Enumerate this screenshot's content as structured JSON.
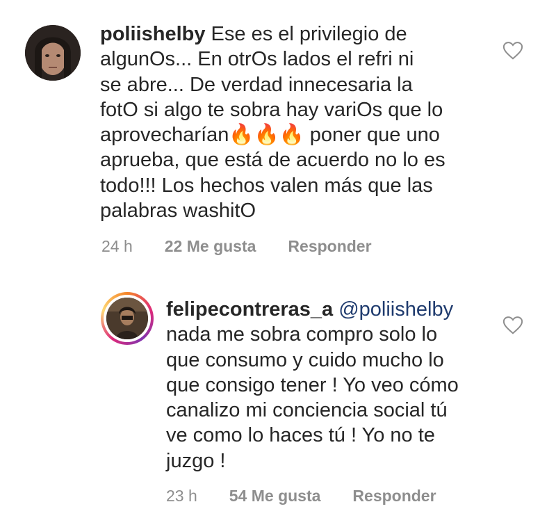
{
  "comments": [
    {
      "username": "poliishelby",
      "text": " Ese es el privilegio de\nalgunOs... En otrOs lados el refri ni\nse abre... De verdad innecesaria la\nfotO si algo te sobra hay variOs que lo\naprovecharían🔥🔥🔥 poner que uno\naprueba, que está de acuerdo no lo es\ntodo!!! Los hechos valen más que las\npalabras washitO",
      "time": "24 h",
      "likes": "22 Me gusta",
      "reply": "Responder",
      "icon": "heart-outline-icon"
    },
    {
      "username": "felipecontreras_a",
      "mention": " @poliishelby",
      "text": "\nnada me sobra compro solo lo\nque consumo y cuido mucho lo\nque consigo tener ! Yo veo cómo\ncanalizo mi conciencia social tú\nve como lo haces tú ! Yo no te\njuzgo !",
      "time": "23 h",
      "likes": "54 Me gusta",
      "reply": "Responder",
      "icon": "heart-outline-icon"
    }
  ]
}
